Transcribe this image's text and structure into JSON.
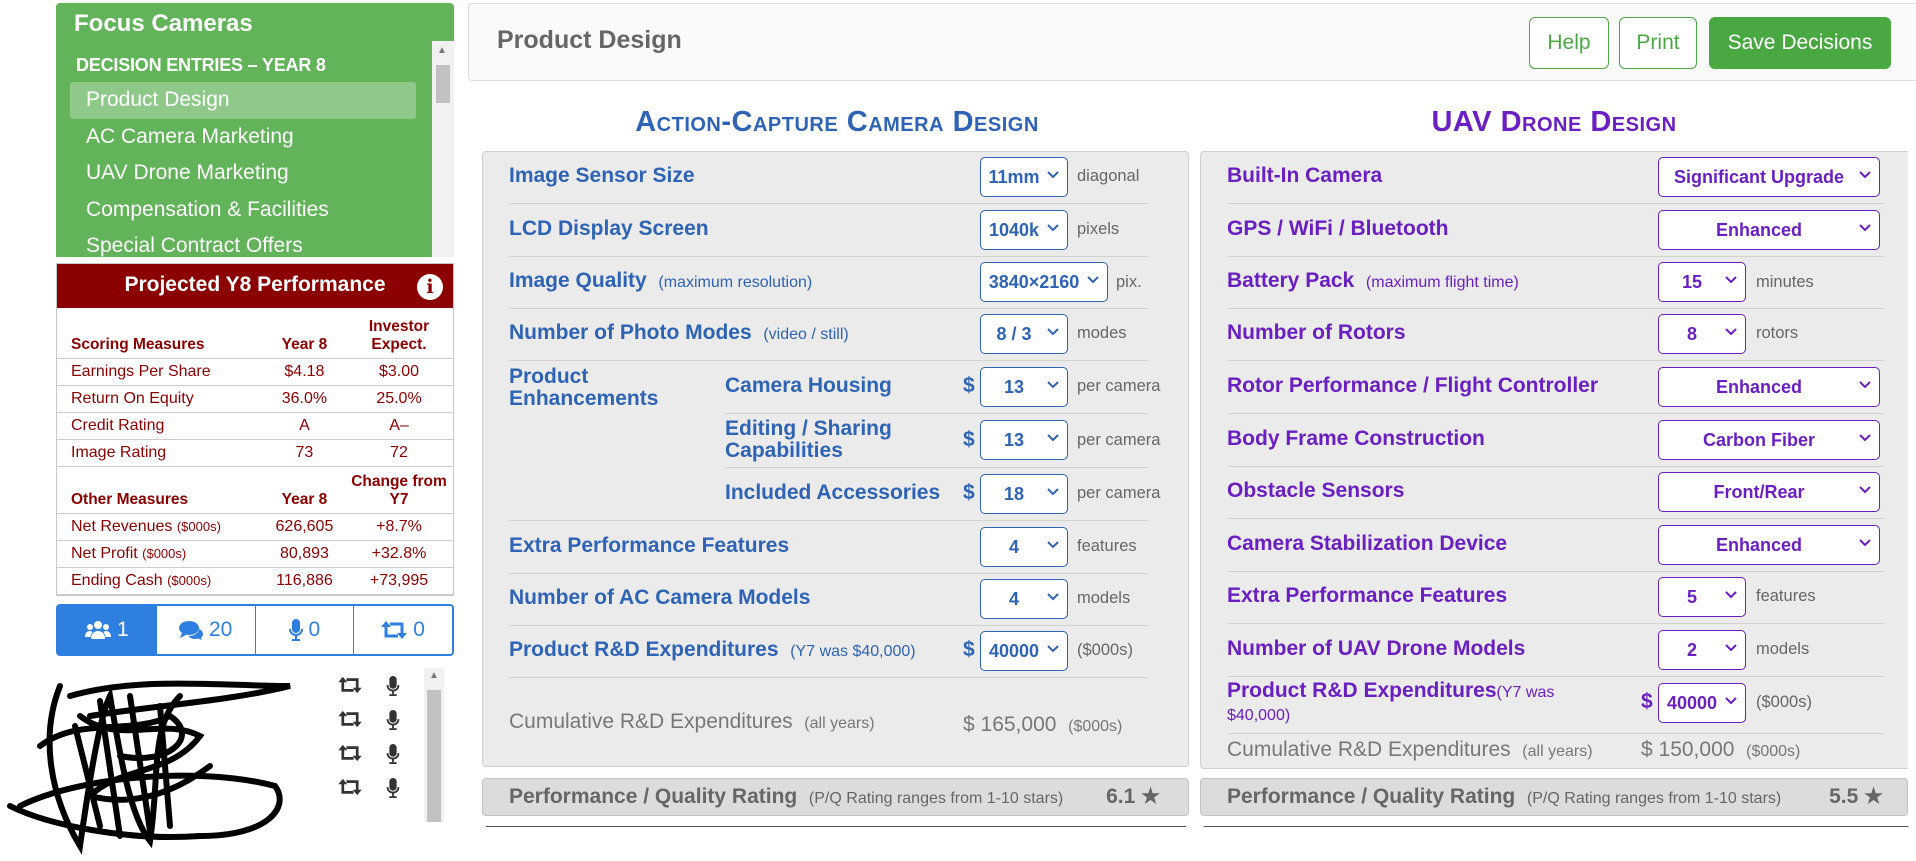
{
  "sidebar": {
    "app_title": "Focus Cameras",
    "section_heading": "DECISION ENTRIES – YEAR 8",
    "nav_items": [
      {
        "label": "Product Design",
        "active": true
      },
      {
        "label": "AC Camera Marketing",
        "active": false
      },
      {
        "label": "UAV Drone Marketing",
        "active": false
      },
      {
        "label": "Compensation & Facilities",
        "active": false
      },
      {
        "label": "Special Contract Offers",
        "active": false
      }
    ]
  },
  "performance": {
    "title": "Projected Y8 Performance",
    "info_icon": "info-icon",
    "scoring_headers": [
      "Scoring Measures",
      "Year 8",
      "Investor Expect."
    ],
    "scoring_rows": [
      {
        "label": "Earnings Per Share",
        "unit": "",
        "year": "$4.18",
        "other": "$3.00"
      },
      {
        "label": "Return On Equity",
        "unit": "",
        "year": "36.0%",
        "other": "25.0%"
      },
      {
        "label": "Credit Rating",
        "unit": "",
        "year": "A",
        "other": "A–"
      },
      {
        "label": "Image Rating",
        "unit": "",
        "year": "73",
        "other": "72"
      }
    ],
    "other_headers": [
      "Other Measures",
      "Year 8",
      "Change from Y7"
    ],
    "other_rows": [
      {
        "label": "Net Revenues",
        "unit": "($000s)",
        "year": "626,605",
        "other": "+8.7%"
      },
      {
        "label": "Net Profit",
        "unit": "($000s)",
        "year": "80,893",
        "other": "+32.8%"
      },
      {
        "label": "Ending Cash",
        "unit": "($000s)",
        "year": "116,886",
        "other": "+73,995"
      }
    ]
  },
  "tabs": [
    {
      "icon": "users-icon",
      "count": "1"
    },
    {
      "icon": "comments-icon",
      "count": "20"
    },
    {
      "icon": "microphone-icon",
      "count": "0"
    },
    {
      "icon": "retweet-icon",
      "count": "0"
    }
  ],
  "header": {
    "title": "Product Design",
    "help": "Help",
    "print": "Print",
    "save": "Save Decisions"
  },
  "ac": {
    "title": "Action-Capture Camera Design",
    "color": "#2e63b5",
    "rows": {
      "sensor": {
        "label": "Image Sensor Size",
        "value": "11mm",
        "unit": "diagonal"
      },
      "lcd": {
        "label": "LCD Display Screen",
        "value": "1040k",
        "unit": "pixels"
      },
      "quality": {
        "label": "Image Quality",
        "sub": "(maximum resolution)",
        "value": "3840×2160",
        "unit": "pix."
      },
      "modes": {
        "label": "Number of Photo Modes",
        "sub": "(video / still)",
        "value": "8 / 3",
        "unit": "modes"
      },
      "enh_label": "Product Enhancements",
      "housing": {
        "label": "Camera Housing",
        "dollar": "$",
        "value": "13",
        "unit": "per camera"
      },
      "editing": {
        "label": "Editing / Sharing Capabilities",
        "dollar": "$",
        "value": "13",
        "unit": "per camera"
      },
      "accessories": {
        "label": "Included Accessories",
        "dollar": "$",
        "value": "18",
        "unit": "per camera"
      },
      "features": {
        "label": "Extra Performance Features",
        "value": "4",
        "unit": "features"
      },
      "models": {
        "label": "Number of AC Camera Models",
        "value": "4",
        "unit": "models"
      },
      "rd": {
        "label": "Product R&D Expenditures",
        "sub": "(Y7 was $40,000)",
        "dollar": "$",
        "value": "40000",
        "unit": "($000s)"
      },
      "cum": {
        "label": "Cumulative R&D Expenditures",
        "sub": "(all years)",
        "value": "$ 165,000",
        "unit": "($000s)"
      }
    },
    "pq": {
      "label": "Performance / Quality Rating",
      "sub": "(P/Q Rating ranges from 1-10 stars)",
      "value": "6.1"
    }
  },
  "uav": {
    "title": "UAV Drone Design",
    "color": "#6a1fc2",
    "rows": {
      "camera": {
        "label": "Built-In Camera",
        "value": "Significant Upgrade"
      },
      "gps": {
        "label": "GPS / WiFi / Bluetooth",
        "value": "Enhanced"
      },
      "battery": {
        "label": "Battery Pack",
        "sub": "(maximum flight time)",
        "value": "15",
        "unit": "minutes"
      },
      "rotors": {
        "label": "Number of Rotors",
        "value": "8",
        "unit": "rotors"
      },
      "rotor_perf": {
        "label": "Rotor Performance / Flight Controller",
        "value": "Enhanced"
      },
      "frame": {
        "label": "Body Frame Construction",
        "value": "Carbon Fiber"
      },
      "obstacle": {
        "label": "Obstacle Sensors",
        "value": "Front/Rear"
      },
      "stab": {
        "label": "Camera Stabilization Device",
        "value": "Enhanced"
      },
      "features": {
        "label": "Extra Performance Features",
        "value": "5",
        "unit": "features"
      },
      "models": {
        "label": "Number of UAV Drone Models",
        "value": "2",
        "unit": "models"
      },
      "rd": {
        "label": "Product R&D Expenditures",
        "sub1": "(Y7 was",
        "sub2": "$40,000)",
        "dollar": "$",
        "value": "40000",
        "unit": "($000s)"
      },
      "cum": {
        "label": "Cumulative R&D Expenditures",
        "sub": "(all years)",
        "value": "$ 150,000",
        "unit": "($000s)"
      }
    },
    "pq": {
      "label": "Performance / Quality Rating",
      "sub": "(P/Q Rating ranges from 1-10 stars)",
      "value": "5.5"
    }
  }
}
